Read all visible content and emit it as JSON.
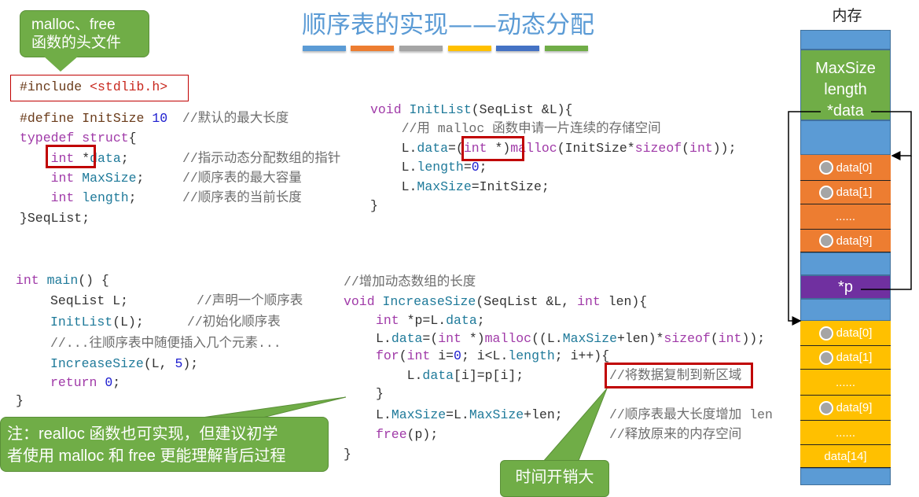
{
  "title": "顺序表的实现——动态分配",
  "title_bar_colors": [
    "#5b9bd5",
    "#ed7d31",
    "#a5a5a5",
    "#ffc000",
    "#4472c4",
    "#70ad47"
  ],
  "colors": {
    "keyword": "#a03aa8",
    "identifier": "#1f7a9a",
    "number": "#1c1ccf",
    "comment": "#6d6d6d",
    "highlight_box": "#c00000",
    "callout": "#70ad47"
  },
  "header_callout": {
    "line1": "malloc、free",
    "line2": "函数的头文件"
  },
  "include_line": [
    {
      "t": "#include ",
      "c": "pp"
    },
    {
      "t": "<stdlib.h>",
      "c": "str"
    }
  ],
  "struct_code": [
    {
      "tokens": [
        {
          "t": "#define ",
          "c": "pp"
        },
        {
          "t": "InitSize ",
          "c": "pp"
        },
        {
          "t": "10",
          "c": "num"
        }
      ],
      "comment": " //默认的最大长度"
    },
    {
      "tokens": [
        {
          "t": "typedef ",
          "c": "kw"
        },
        {
          "t": "struct",
          "c": "kw"
        },
        {
          "t": "{",
          "c": "tx"
        }
      ],
      "comment": ""
    },
    {
      "tokens": [
        {
          "t": "    int ",
          "c": "kw"
        },
        {
          "t": "*",
          "c": "tx"
        },
        {
          "t": "data",
          "c": "id"
        },
        {
          "t": ";",
          "c": "tx"
        }
      ],
      "comment": "//指示动态分配数组的指针"
    },
    {
      "tokens": [
        {
          "t": "    int ",
          "c": "kw"
        },
        {
          "t": "MaxSize",
          "c": "id"
        },
        {
          "t": ";",
          "c": "tx"
        }
      ],
      "comment": "//顺序表的最大容量"
    },
    {
      "tokens": [
        {
          "t": "    int ",
          "c": "kw"
        },
        {
          "t": "length",
          "c": "id"
        },
        {
          "t": ";",
          "c": "tx"
        }
      ],
      "comment": "//顺序表的当前长度"
    },
    {
      "tokens": [
        {
          "t": "}SeqList;",
          "c": "tx"
        }
      ],
      "comment": ""
    }
  ],
  "initlist_code": [
    [
      {
        "t": "void ",
        "c": "kw"
      },
      {
        "t": "InitList",
        "c": "id"
      },
      {
        "t": "(SeqList &L){",
        "c": "tx"
      }
    ],
    [
      {
        "t": "    //用 malloc 函数申请一片连续的存储空间",
        "c": "cm"
      }
    ],
    [
      {
        "t": "    L.",
        "c": "tx"
      },
      {
        "t": "data",
        "c": "id"
      },
      {
        "t": "=(",
        "c": "tx"
      },
      {
        "t": "int ",
        "c": "kw"
      },
      {
        "t": "*)",
        "c": "tx"
      },
      {
        "t": "malloc",
        "c": "kw"
      },
      {
        "t": "(InitSize*",
        "c": "tx"
      },
      {
        "t": "sizeof",
        "c": "kw"
      },
      {
        "t": "(",
        "c": "tx"
      },
      {
        "t": "int",
        "c": "kw"
      },
      {
        "t": "));",
        "c": "tx"
      }
    ],
    [
      {
        "t": "    L.",
        "c": "tx"
      },
      {
        "t": "length",
        "c": "id"
      },
      {
        "t": "=",
        "c": "tx"
      },
      {
        "t": "0",
        "c": "num"
      },
      {
        "t": ";",
        "c": "tx"
      }
    ],
    [
      {
        "t": "    L.",
        "c": "tx"
      },
      {
        "t": "MaxSize",
        "c": "id"
      },
      {
        "t": "=InitSize;",
        "c": "tx"
      }
    ],
    [
      {
        "t": "}",
        "c": "tx"
      }
    ]
  ],
  "main_code": [
    {
      "tokens": [
        {
          "t": "int ",
          "c": "kw"
        },
        {
          "t": "main",
          "c": "id"
        },
        {
          "t": "() {",
          "c": "tx"
        }
      ],
      "comment": ""
    },
    {
      "tokens": [
        {
          "t": "SeqList L;",
          "c": "tx"
        }
      ],
      "comment": "//声明一个顺序表"
    },
    {
      "tokens": [
        {
          "t": "InitList",
          "c": "id"
        },
        {
          "t": "(L);",
          "c": "tx"
        }
      ],
      "comment": "//初始化顺序表"
    },
    {
      "tokens": [
        {
          "t": "//...往顺序表中随便插入几个元素...",
          "c": "cm"
        }
      ],
      "comment": ""
    },
    {
      "tokens": [
        {
          "t": "IncreaseSize",
          "c": "id"
        },
        {
          "t": "(L, ",
          "c": "tx"
        },
        {
          "t": "5",
          "c": "num"
        },
        {
          "t": ");",
          "c": "tx"
        }
      ],
      "comment": ""
    },
    {
      "tokens": [
        {
          "t": "return ",
          "c": "kw"
        },
        {
          "t": "0",
          "c": "num"
        },
        {
          "t": ";",
          "c": "tx"
        }
      ],
      "comment": ""
    },
    {
      "tokens": [
        {
          "t": "}",
          "c": "tx"
        }
      ],
      "comment": ""
    }
  ],
  "increase_code": [
    {
      "tokens": [
        {
          "t": "//增加动态数组的长度",
          "c": "cm"
        }
      ],
      "comment": ""
    },
    {
      "tokens": [
        {
          "t": "void ",
          "c": "kw"
        },
        {
          "t": "IncreaseSize",
          "c": "id"
        },
        {
          "t": "(SeqList &L, ",
          "c": "tx"
        },
        {
          "t": "int ",
          "c": "kw"
        },
        {
          "t": "len){",
          "c": "tx"
        }
      ],
      "comment": ""
    },
    {
      "tokens": [
        {
          "t": "int ",
          "c": "kw"
        },
        {
          "t": "*p=L.",
          "c": "tx"
        },
        {
          "t": "data",
          "c": "id"
        },
        {
          "t": ";",
          "c": "tx"
        }
      ],
      "comment": ""
    },
    {
      "tokens": [
        {
          "t": "L.",
          "c": "tx"
        },
        {
          "t": "data",
          "c": "id"
        },
        {
          "t": "=(",
          "c": "tx"
        },
        {
          "t": "int ",
          "c": "kw"
        },
        {
          "t": "*)",
          "c": "tx"
        },
        {
          "t": "malloc",
          "c": "kw"
        },
        {
          "t": "((L.",
          "c": "tx"
        },
        {
          "t": "MaxSize",
          "c": "id"
        },
        {
          "t": "+len)*",
          "c": "tx"
        },
        {
          "t": "sizeof",
          "c": "kw"
        },
        {
          "t": "(",
          "c": "tx"
        },
        {
          "t": "int",
          "c": "kw"
        },
        {
          "t": "));",
          "c": "tx"
        }
      ],
      "comment": ""
    },
    {
      "tokens": [
        {
          "t": "for",
          "c": "kw"
        },
        {
          "t": "(",
          "c": "tx"
        },
        {
          "t": "int ",
          "c": "kw"
        },
        {
          "t": "i=",
          "c": "tx"
        },
        {
          "t": "0",
          "c": "num"
        },
        {
          "t": "; i<L.",
          "c": "tx"
        },
        {
          "t": "length",
          "c": "id"
        },
        {
          "t": "; i++){",
          "c": "tx"
        }
      ],
      "comment": ""
    },
    {
      "tokens": [
        {
          "t": "    L.",
          "c": "tx"
        },
        {
          "t": "data",
          "c": "id"
        },
        {
          "t": "[i]=p[i];",
          "c": "tx"
        }
      ],
      "comment": "//将数据复制到新区域"
    },
    {
      "tokens": [
        {
          "t": "}",
          "c": "tx"
        }
      ],
      "comment": ""
    },
    {
      "tokens": [
        {
          "t": "L.",
          "c": "tx"
        },
        {
          "t": "MaxSize",
          "c": "id"
        },
        {
          "t": "=L.",
          "c": "tx"
        },
        {
          "t": "MaxSize",
          "c": "id"
        },
        {
          "t": "+len;",
          "c": "tx"
        }
      ],
      "comment": "//顺序表最大长度增加 len"
    },
    {
      "tokens": [
        {
          "t": "free",
          "c": "kw"
        },
        {
          "t": "(p);",
          "c": "tx"
        }
      ],
      "comment": "//释放原来的内存空间"
    },
    {
      "tokens": [
        {
          "t": "}",
          "c": "tx"
        }
      ],
      "comment": ""
    }
  ],
  "note_callout": {
    "line1": "注：realloc 函数也可实现，但建议初学",
    "line2": "者使用 malloc 和 free 更能理解背后过程"
  },
  "cost_callout": "时间开销大",
  "memory": {
    "label": "内存",
    "struct_fields": [
      "MaxSize",
      "length",
      "*data"
    ],
    "old_array": [
      "data[0]",
      "data[1]",
      "......",
      "data[9]"
    ],
    "pointer_p": "*p",
    "new_array": [
      "data[0]",
      "data[1]",
      "......",
      "data[9]",
      "......",
      "data[14]"
    ],
    "colors": {
      "free": "#5b9bd5",
      "struct": "#70ad47",
      "old_array": "#ed7d31",
      "pointer": "#7030a0",
      "new_array": "#ffc000"
    }
  },
  "arrow_colors": {
    "main": [
      "#70ad47",
      "#5b9bd5",
      "#5b9bd5",
      "#5b9bd5"
    ],
    "initlist": "#ed7d31",
    "increase": [
      "#7030a0",
      "#ffc000",
      "#5b9bd5",
      "#5b9bd5",
      "#ed7d31"
    ]
  }
}
